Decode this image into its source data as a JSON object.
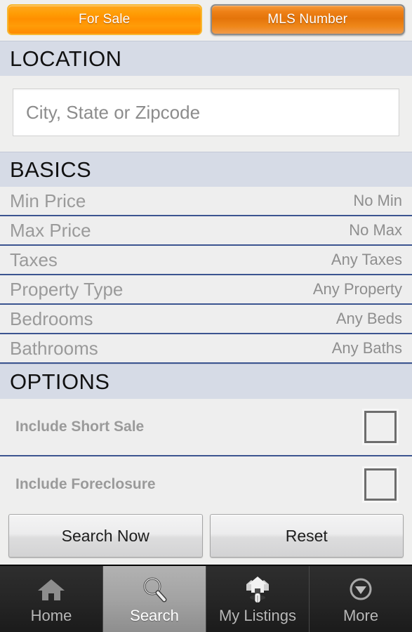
{
  "toggle": {
    "options": [
      {
        "label": "For Sale",
        "state": "active"
      },
      {
        "label": "MLS Number",
        "state": "inactive"
      }
    ]
  },
  "sections": {
    "location": {
      "header": "LOCATION",
      "input": {
        "value": "",
        "placeholder": "City, State or Zipcode"
      }
    },
    "basics": {
      "header": "BASICS",
      "rows": [
        {
          "label": "Min Price",
          "value": "No Min"
        },
        {
          "label": "Max Price",
          "value": "No Max"
        },
        {
          "label": "Taxes",
          "value": "Any Taxes"
        },
        {
          "label": "Property Type",
          "value": "Any Property"
        },
        {
          "label": "Bedrooms",
          "value": "Any Beds"
        },
        {
          "label": "Bathrooms",
          "value": "Any Baths"
        }
      ]
    },
    "options": {
      "header": "OPTIONS",
      "rows": [
        {
          "label": "Include Short Sale",
          "checked": false
        },
        {
          "label": "Include Foreclosure",
          "checked": false
        }
      ]
    }
  },
  "actions": {
    "search_label": "Search Now",
    "reset_label": "Reset"
  },
  "tabbar": {
    "tabs": [
      {
        "label": "Home",
        "icon": "home-icon",
        "active": false
      },
      {
        "label": "Search",
        "icon": "magnifier-icon",
        "active": true
      },
      {
        "label": "My Listings",
        "icon": "houses-pin-icon",
        "active": false
      },
      {
        "label": "More",
        "icon": "chevron-down-circle-icon",
        "active": false
      }
    ]
  },
  "colors": {
    "accent_orange": "#ff8f00",
    "accent_orange_border": "#f7b731",
    "section_header_bg": "#d6dbe6",
    "row_separator": "#3b5490",
    "row_bg": "#eeeeee",
    "page_bg": "#efefee",
    "tab_bg": "#262626",
    "tab_active_bg": "#a3a3a3"
  }
}
